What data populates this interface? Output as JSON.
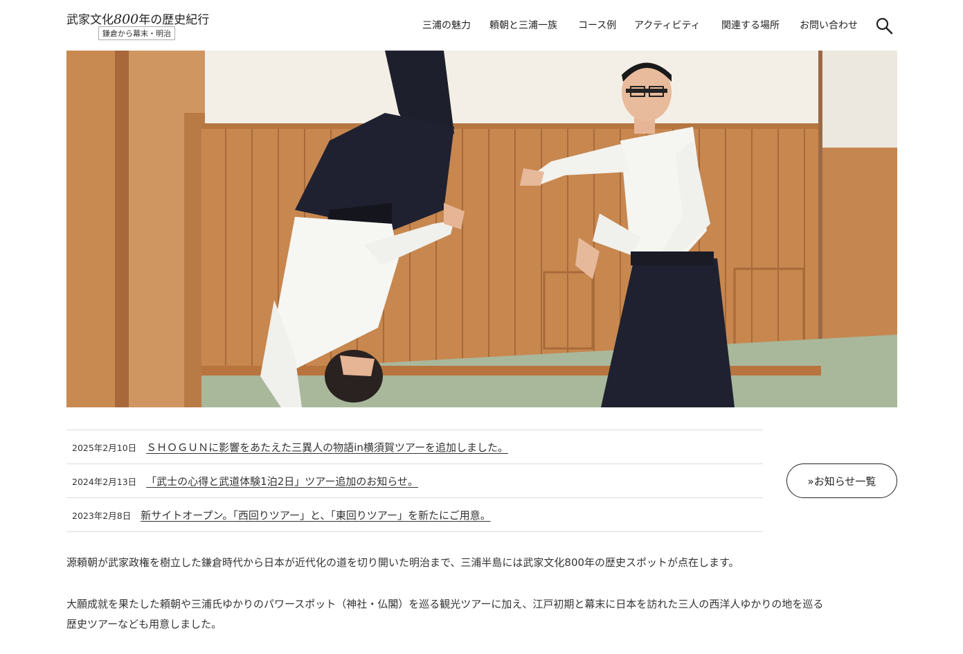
{
  "header": {
    "logo_main_prefix": "武家文化",
    "logo_main_number": "800",
    "logo_main_suffix": "年の歴史紀行",
    "logo_sub": "鎌倉から幕末・明治",
    "nav": [
      {
        "label": "三浦の魅力"
      },
      {
        "label": "頼朝と三浦一族"
      },
      {
        "label": "コース例"
      },
      {
        "label": "アクティビティ"
      },
      {
        "label": "関連する場所"
      },
      {
        "label": "お問い合わせ"
      }
    ]
  },
  "hero": {
    "icon": "aikido-throw-photo"
  },
  "news": {
    "items": [
      {
        "date": "2025年2月10日",
        "title": "ＳＨＯＧＵＮに影響をあたえた三異人の物語in横須賀ツアーを追加しました。"
      },
      {
        "date": "2024年2月13日",
        "title": "「武士の心得と武道体験1泊2日」ツアー追加のお知らせ。"
      },
      {
        "date": "2023年2月8日",
        "title": "新サイトオープン。「西回りツアー」と、「東回りツアー」を新たにご用意。"
      }
    ],
    "all_button": "»お知らせ一覧"
  },
  "intro": {
    "p1": "源頼朝が武家政権を樹立した鎌倉時代から日本が近代化の道を切り開いた明治まで、三浦半島には武家文化800年の歴史スポットが点在します。",
    "p2_line1": "大願成就を果たした頼朝や三浦氏ゆかりのパワースポット（神社・仏閣）を巡る観光ツアーに加え、江戸初期と幕末に日本を訪れた三人の西洋人ゆかりの地を巡る",
    "p2_line2": "歴史ツアーなども用意しました。"
  }
}
